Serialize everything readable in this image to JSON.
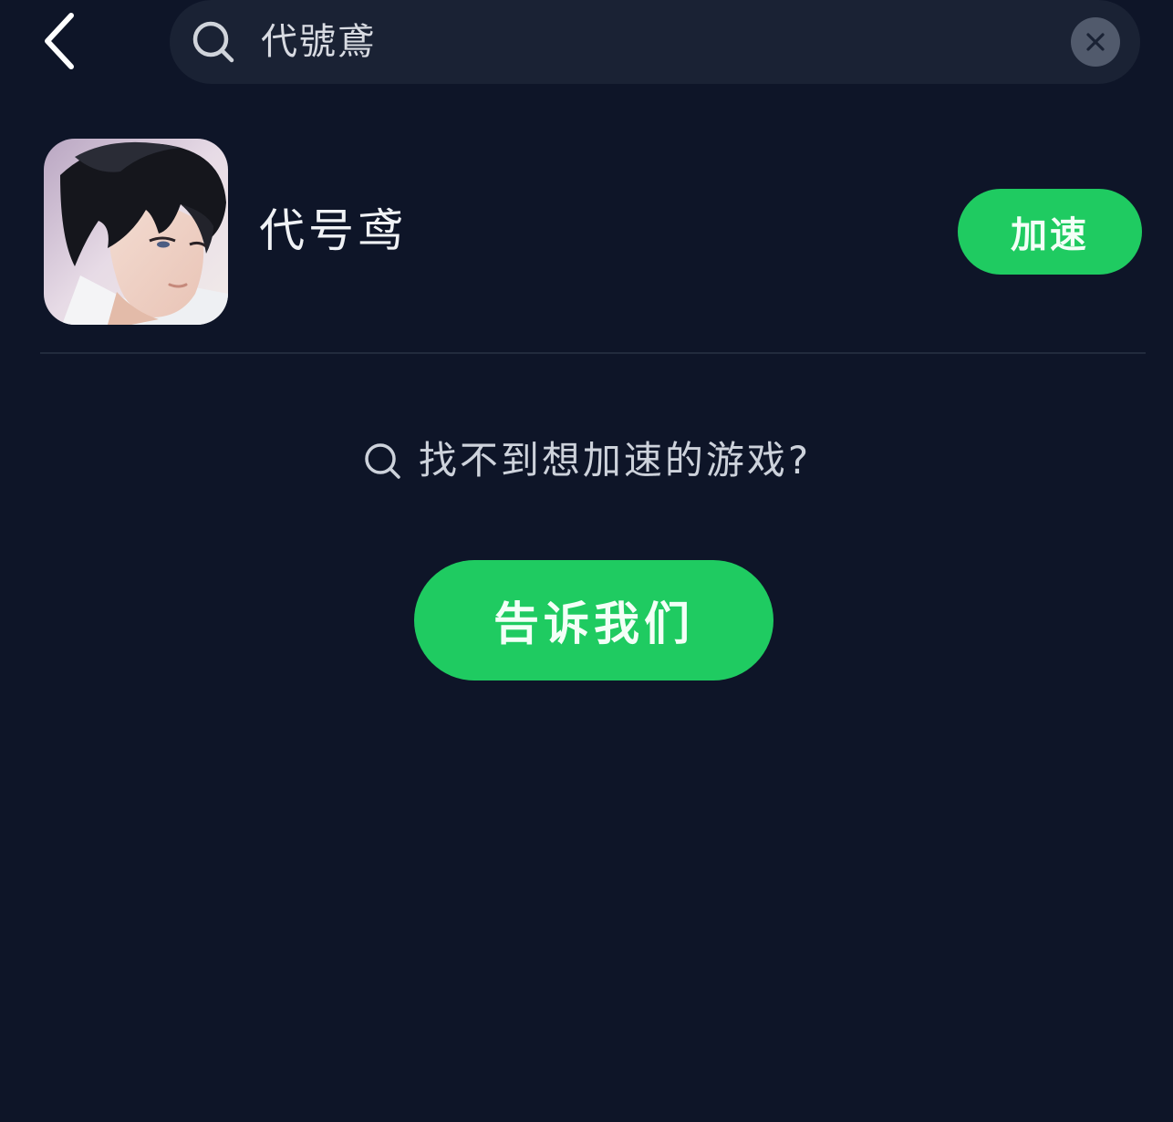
{
  "header": {
    "back_icon": "chevron-left-icon",
    "search": {
      "icon": "search-icon",
      "value": "代號鳶",
      "clear_icon": "close-icon"
    }
  },
  "results": [
    {
      "title": "代号鸢",
      "icon": "game-cover-art",
      "action_label": "加速"
    }
  ],
  "empty_prompt": {
    "icon": "search-icon",
    "text": "找不到想加速的游戏?"
  },
  "feedback_button": {
    "label": "告诉我们"
  },
  "colors": {
    "background": "#0e1528",
    "search_bg": "#1a2234",
    "accent_green": "#1fcb61",
    "clear_button": "#515a6c"
  }
}
